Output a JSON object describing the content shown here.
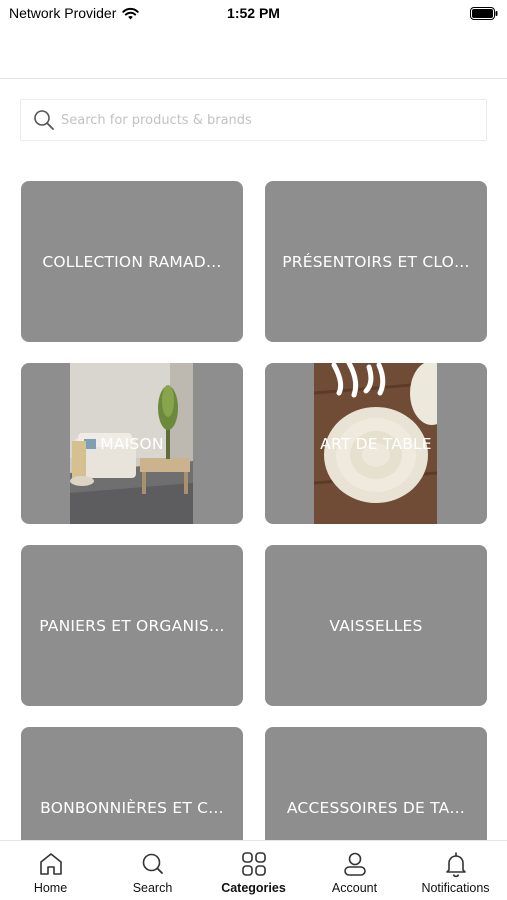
{
  "status_bar": {
    "carrier": "Network Provider",
    "time": "1:52 PM"
  },
  "search": {
    "placeholder": "Search for products & brands",
    "icon": "search-icon"
  },
  "categories": [
    {
      "label": "COLLECTION RAMAD…",
      "has_image": false
    },
    {
      "label": "PRÉSENTOIRS ET CLO…",
      "has_image": false
    },
    {
      "label": "MAISON",
      "has_image": true,
      "image": "living-room-photo"
    },
    {
      "label": "ART DE TABLE",
      "has_image": true,
      "image": "plates-photo"
    },
    {
      "label": "PANIERS ET ORGANIS…",
      "has_image": false
    },
    {
      "label": "VAISSELLES",
      "has_image": false
    },
    {
      "label": "BONBONNIÈRES ET C…",
      "has_image": false
    },
    {
      "label": "ACCESSOIRES DE TA…",
      "has_image": false
    }
  ],
  "tab_bar": {
    "tabs": [
      {
        "label": "Home",
        "icon": "home-icon",
        "active": false
      },
      {
        "label": "Search",
        "icon": "search-icon",
        "active": false
      },
      {
        "label": "Categories",
        "icon": "grid-icon",
        "active": true
      },
      {
        "label": "Account",
        "icon": "user-icon",
        "active": false
      },
      {
        "label": "Notifications",
        "icon": "bell-icon",
        "active": false
      }
    ]
  },
  "colors": {
    "tile_background": "#8e8e8f",
    "tile_text": "#ffffff",
    "placeholder": "#c2c2c2"
  }
}
